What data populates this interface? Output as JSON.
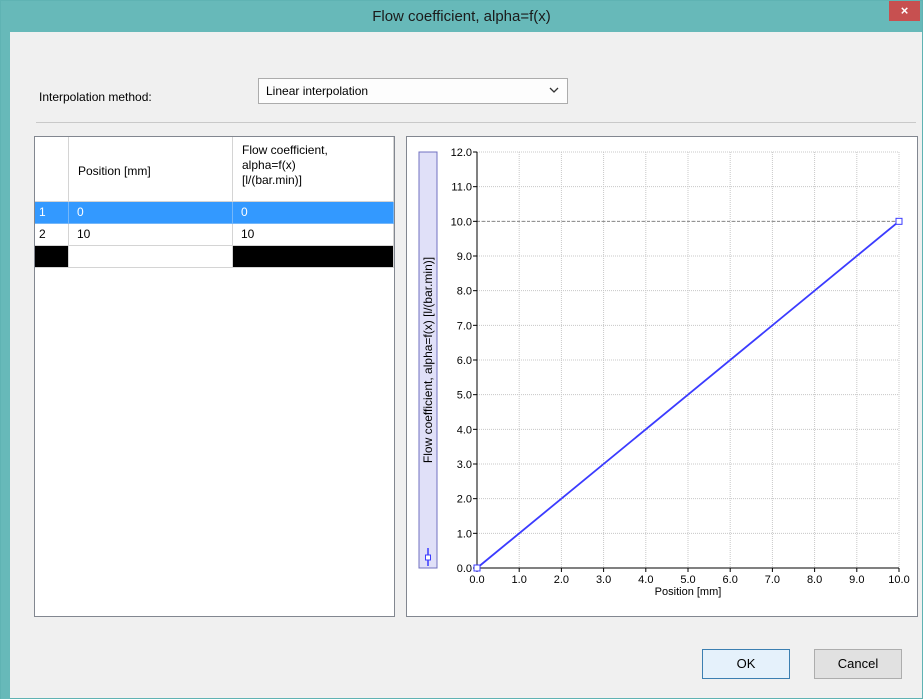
{
  "window": {
    "title": "Flow coefficient, alpha=f(x)",
    "close_glyph": "×"
  },
  "interpolation": {
    "label": "Interpolation method:",
    "value": "Linear interpolation",
    "arrow_icon": "chevron-down-icon"
  },
  "table": {
    "headers": {
      "number": "",
      "position": "Position [mm]",
      "flow_line1": "Flow coefficient,",
      "flow_line2": "alpha=f(x)",
      "flow_line3": "[l/(bar.min)]"
    },
    "rows": [
      {
        "num": "1",
        "position": "0",
        "flow": "0",
        "selected": true
      },
      {
        "num": "2",
        "position": "10",
        "flow": "10",
        "selected": false
      },
      {
        "num": "",
        "position": "",
        "flow": "",
        "selected": false
      }
    ]
  },
  "chart_data": {
    "type": "line",
    "xlabel": "Position [mm]",
    "ylabel": "Flow coefficient, alpha=f(x)   [l/(bar.min)]",
    "xlim": [
      0,
      10
    ],
    "ylim": [
      0,
      12
    ],
    "xticks": [
      "0.0",
      "1.0",
      "2.0",
      "3.0",
      "4.0",
      "5.0",
      "6.0",
      "7.0",
      "8.0",
      "9.0",
      "10.0"
    ],
    "yticks": [
      "0.0",
      "1.0",
      "2.0",
      "3.0",
      "4.0",
      "5.0",
      "6.0",
      "7.0",
      "8.0",
      "9.0",
      "10.0",
      "11.0",
      "12.0"
    ],
    "grid": true,
    "series": [
      {
        "x": [
          0,
          10
        ],
        "y": [
          0,
          10
        ],
        "color": "#3b3bff"
      }
    ],
    "reference_line_y": 10
  },
  "buttons": {
    "ok": "OK",
    "cancel": "Cancel"
  },
  "colors": {
    "titlebar": "#67b9b9",
    "selection": "#3399ff",
    "series": "#3b3bff",
    "close": "#c75050"
  }
}
